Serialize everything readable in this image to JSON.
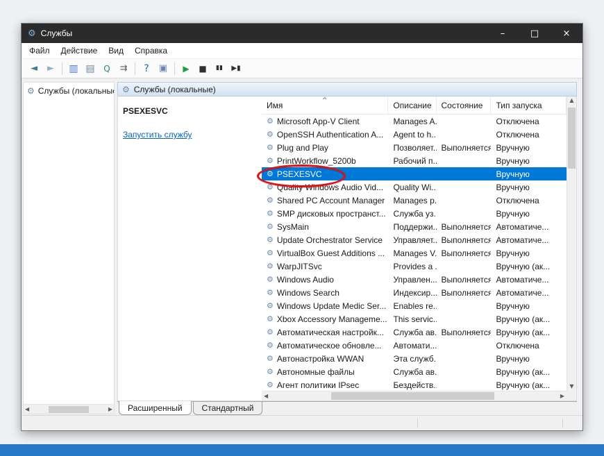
{
  "colors": {
    "selection": "#0078d7",
    "link": "#0563c1",
    "annotation": "#dd1111",
    "taskbar": "#2a79c7",
    "titlebar": "#2b2b2b"
  },
  "window": {
    "title": "Службы",
    "app_icon_glyph": "⚙",
    "minimize_glyph": "–",
    "maximize_glyph": "□",
    "close_glyph": "×"
  },
  "menu": {
    "items": [
      {
        "id": "file",
        "label": "Файл"
      },
      {
        "id": "action",
        "label": "Действие"
      },
      {
        "id": "view",
        "label": "Вид"
      },
      {
        "id": "help",
        "label": "Справка"
      }
    ]
  },
  "toolbar": {
    "items": [
      {
        "type": "icon",
        "name": "back-icon",
        "glyph": "◄",
        "color": "#3c7a99",
        "size": 13
      },
      {
        "type": "icon",
        "name": "forward-icon",
        "glyph": "►",
        "color": "#8fb0c2",
        "size": 13
      },
      {
        "type": "sep"
      },
      {
        "type": "icon",
        "name": "show-console-tree-icon",
        "glyph": "▥",
        "color": "#4a78c8",
        "size": 14
      },
      {
        "type": "icon",
        "name": "properties-icon",
        "glyph": "▤",
        "color": "#6a87ad",
        "size": 14
      },
      {
        "type": "icon",
        "name": "export-list-icon",
        "glyph": "Q",
        "color": "#2e8b57",
        "size": 12
      },
      {
        "type": "icon",
        "name": "export-icon",
        "glyph": "⇉",
        "color": "#55606c",
        "size": 13
      },
      {
        "type": "sep"
      },
      {
        "type": "icon",
        "name": "help-icon",
        "glyph": "?",
        "color": "#1f5fbf",
        "size": 14
      },
      {
        "type": "icon",
        "name": "new-window-icon",
        "glyph": "▣",
        "color": "#6a87ad",
        "size": 13
      },
      {
        "type": "sep"
      },
      {
        "type": "icon",
        "name": "start-service-icon",
        "glyph": "▶",
        "color": "#1e9e3e",
        "size": 12
      },
      {
        "type": "icon",
        "name": "stop-service-icon",
        "glyph": "■",
        "color": "#2f2f2f",
        "size": 12
      },
      {
        "type": "icon",
        "name": "pause-service-icon",
        "glyph": "▮▮",
        "color": "#2f2f2f",
        "size": 9
      },
      {
        "type": "icon",
        "name": "restart-service-icon",
        "glyph": "▶▮",
        "color": "#2f2f2f",
        "size": 10
      }
    ]
  },
  "tree": {
    "root_icon_glyph": "⚙",
    "root_label": "Службы (локальные)"
  },
  "services_panel": {
    "header_icon_glyph": "⚙",
    "header": "Службы (локальные)",
    "selected_service_name": "PSEXESVC",
    "action_link": "Запустить службу"
  },
  "table": {
    "columns": [
      "Имя",
      "Описание",
      "Состояние",
      "Тип запуска"
    ],
    "sort_caret_glyph": "^",
    "row_icon_glyph": "⚙",
    "selected_index": 4,
    "rows": [
      {
        "name": "Microsoft App-V Client",
        "desc": "Manages A...",
        "status": "",
        "startup": "Отключена"
      },
      {
        "name": "OpenSSH Authentication A...",
        "desc": "Agent to h...",
        "status": "",
        "startup": "Отключена"
      },
      {
        "name": "Plug and Play",
        "desc": "Позволяет...",
        "status": "Выполняется",
        "startup": "Вручную"
      },
      {
        "name": "PrintWorkflow_5200b",
        "desc": "Рабочий п...",
        "status": "",
        "startup": "Вручную"
      },
      {
        "name": "PSEXESVC",
        "desc": "",
        "status": "",
        "startup": "Вручную"
      },
      {
        "name": "Quality Windows Audio Vid...",
        "desc": "Quality Wi...",
        "status": "",
        "startup": "Вручную"
      },
      {
        "name": "Shared PC Account Manager",
        "desc": "Manages p...",
        "status": "",
        "startup": "Отключена"
      },
      {
        "name": "SMP дисковых пространст...",
        "desc": "Служба уз...",
        "status": "",
        "startup": "Вручную"
      },
      {
        "name": "SysMain",
        "desc": "Поддержи...",
        "status": "Выполняется",
        "startup": "Автоматиче..."
      },
      {
        "name": "Update Orchestrator Service",
        "desc": "Управляет...",
        "status": "Выполняется",
        "startup": "Автоматиче..."
      },
      {
        "name": "VirtualBox Guest Additions ...",
        "desc": "Manages V...",
        "status": "Выполняется",
        "startup": "Вручную"
      },
      {
        "name": "WarpJITSvc",
        "desc": "Provides a ...",
        "status": "",
        "startup": "Вручную (ак..."
      },
      {
        "name": "Windows Audio",
        "desc": "Управлен...",
        "status": "Выполняется",
        "startup": "Автоматиче..."
      },
      {
        "name": "Windows Search",
        "desc": "Индексир...",
        "status": "Выполняется",
        "startup": "Автоматиче..."
      },
      {
        "name": "Windows Update Medic Ser...",
        "desc": "Enables re...",
        "status": "",
        "startup": "Вручную"
      },
      {
        "name": "Xbox Accessory Manageme...",
        "desc": "This servic...",
        "status": "",
        "startup": "Вручную (ак..."
      },
      {
        "name": "Автоматическая настройк...",
        "desc": "Служба ав...",
        "status": "Выполняется",
        "startup": "Вручную (ак..."
      },
      {
        "name": "Автоматическое обновле...",
        "desc": "Автомати...",
        "status": "",
        "startup": "Отключена"
      },
      {
        "name": "Автонастройка WWAN",
        "desc": "Эта служб...",
        "status": "",
        "startup": "Вручную"
      },
      {
        "name": "Автономные файлы",
        "desc": "Служба ав...",
        "status": "",
        "startup": "Вручную (ак..."
      },
      {
        "name": "Агент политики IPsec",
        "desc": "Бездейств...",
        "status": "",
        "startup": "Вручную (ак..."
      }
    ]
  },
  "tabs": [
    {
      "id": "extended",
      "label": "Расширенный",
      "active": true
    },
    {
      "id": "standard",
      "label": "Стандартный",
      "active": false
    }
  ],
  "scrollbar": {
    "up": "▲",
    "down": "▼",
    "left": "◀",
    "right": "▶"
  }
}
